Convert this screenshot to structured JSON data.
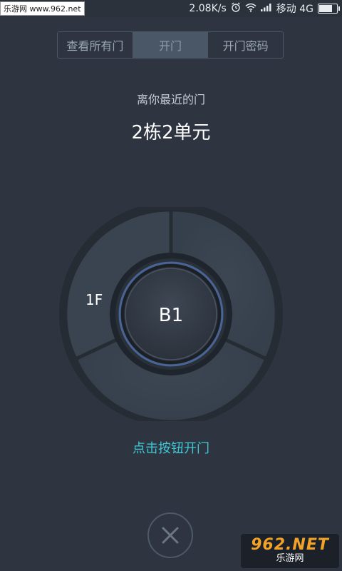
{
  "status_bar": {
    "watermark": "乐游网 www.962.net",
    "speed": "2.08K/s",
    "carrier": "移动 4G",
    "battery_level": 0.8
  },
  "tabs": [
    {
      "label": "查看所有门",
      "active": false
    },
    {
      "label": "开门",
      "active": true
    },
    {
      "label": "开门密码",
      "active": false
    }
  ],
  "nearest_label": "离你最近的门",
  "door_name": "2栋2单元",
  "dial": {
    "floor_left": "1F",
    "center_label": "B1"
  },
  "hint": "点击按钮开门",
  "close_button": {
    "icon": "close-icon"
  },
  "badge": {
    "logo": "962.NET",
    "subtitle": "乐游网"
  },
  "colors": {
    "background": "#2e3540",
    "accent": "#3fc8d6",
    "ring_glow": "#4f6fa8"
  }
}
